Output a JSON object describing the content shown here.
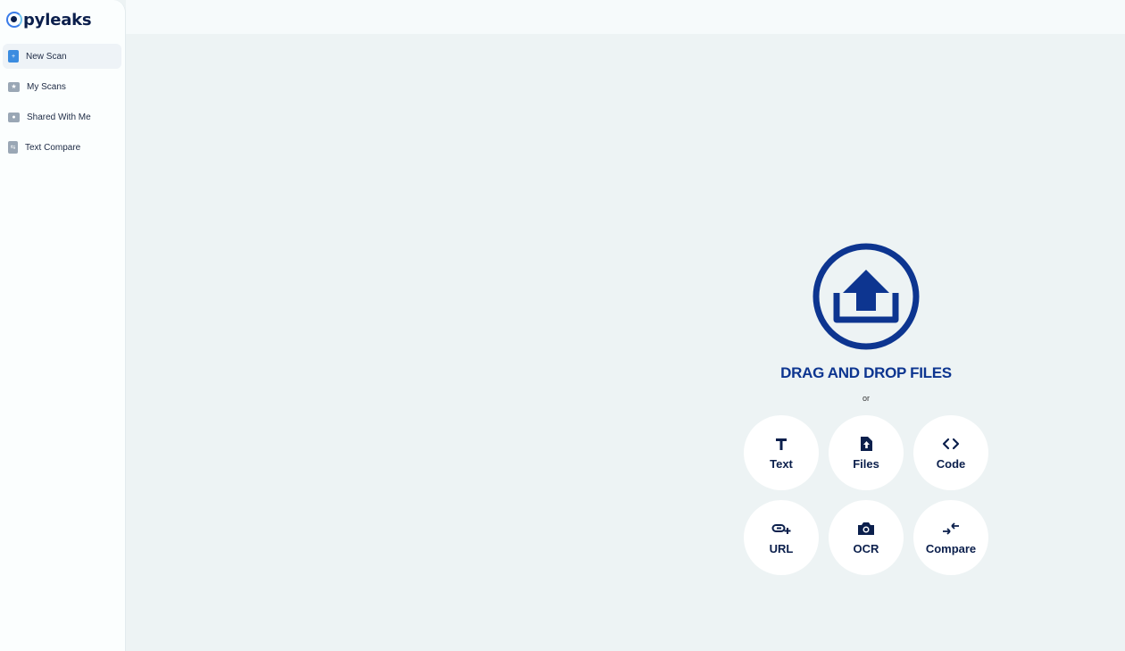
{
  "brand": {
    "name": "Copyleaks",
    "logo_letter": "C",
    "rest": "pyleaks"
  },
  "sidebar": {
    "items": [
      {
        "label": "New Scan",
        "icon": "new-scan-icon",
        "active": true
      },
      {
        "label": "My Scans",
        "icon": "folder-star-icon",
        "active": false
      },
      {
        "label": "Shared With Me",
        "icon": "shared-folder-icon",
        "active": false
      },
      {
        "label": "Text Compare",
        "icon": "text-compare-icon",
        "active": false
      }
    ]
  },
  "dropzone": {
    "icon": "upload-icon",
    "title": "DRAG AND DROP FILES",
    "or": "or"
  },
  "options": [
    {
      "label": "Text",
      "icon": "text-icon"
    },
    {
      "label": "Files",
      "icon": "file-upload-icon"
    },
    {
      "label": "Code",
      "icon": "code-icon"
    },
    {
      "label": "URL",
      "icon": "link-add-icon"
    },
    {
      "label": "OCR",
      "icon": "camera-icon"
    },
    {
      "label": "Compare",
      "icon": "compare-arrows-icon"
    }
  ],
  "colors": {
    "accent": "#0d3590",
    "brand_blue": "#3b8ce0",
    "background": "#edf3f4"
  }
}
